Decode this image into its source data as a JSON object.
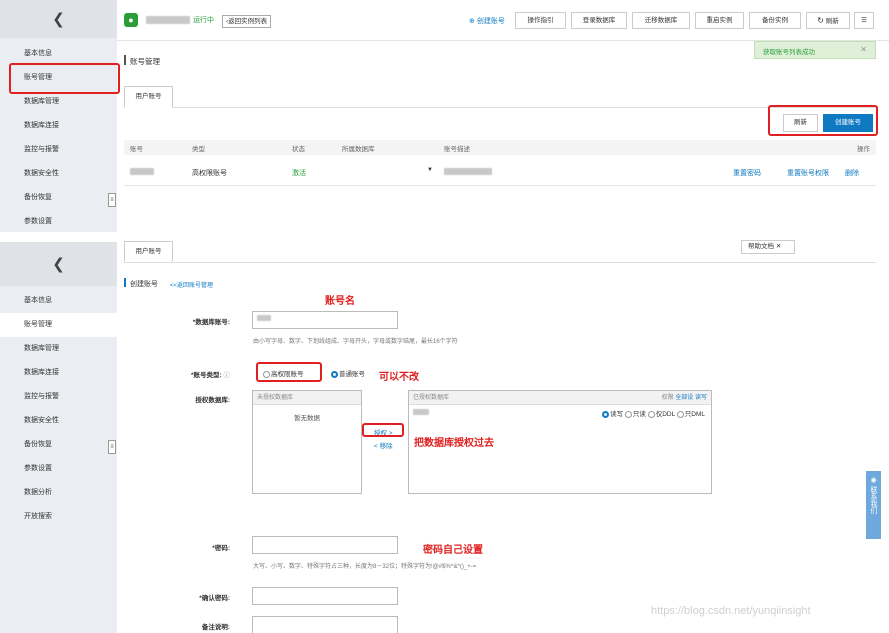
{
  "top": {
    "instance_status": "运行中",
    "back_to_list": "返回实例列表",
    "create_account_link": "创建账号",
    "toolbar_buttons": [
      "操作指引",
      "登录数据库",
      "迁移数据库",
      "重启实例",
      "备份实例",
      "刷新"
    ],
    "page_title": "账号管理",
    "tab_user_account": "用户账号",
    "toast": "获取账号列表成功",
    "refresh_button": "刷新",
    "create_button": "创建账号",
    "table": {
      "headers": [
        "账号",
        "类型",
        "状态",
        "所属数据库",
        "账号描述",
        "操作"
      ],
      "row": {
        "type": "高权限账号",
        "status": "激活"
      },
      "actions": [
        "重置密码",
        "重置账号权限",
        "删除"
      ]
    }
  },
  "sidebar_top": [
    "基本信息",
    "账号管理",
    "数据库管理",
    "数据库连接",
    "监控与报警",
    "数据安全性",
    "备份恢复",
    "参数设置"
  ],
  "sidebar_bottom": [
    "基本信息",
    "账号管理",
    "数据库管理",
    "数据库连接",
    "监控与报警",
    "数据安全性",
    "备份恢复",
    "参数设置",
    "数据分析",
    "开放搜索"
  ],
  "bottom": {
    "tab_user_account": "用户账号",
    "help_doc": "帮助文档",
    "page_title": "创建账号",
    "back_link": "<<返回账号管理",
    "db_account_label": "*数据库账号:",
    "db_account_hint": "由小写字母、数字、下划线组成、字母开头，字母或数字结尾，最长16个字符",
    "account_type_label": "*账号类型:",
    "type_high": "高权限账号",
    "type_normal": "普通账号",
    "auth_db_label": "授权数据库:",
    "unauth_header": "未授权数据库",
    "no_data": "暂无数据",
    "authorize_link": "授权 >",
    "remove_link": "< 移除",
    "authed_header": "已授权数据库",
    "authed_header_right": "权限",
    "all_set": "全部设",
    "set_rw": "读写",
    "perm_options": [
      "读写",
      "只读",
      "仅DDL",
      "只DML"
    ],
    "password_label": "*密码:",
    "password_hint": "大写、小写、数字、特殊字符占三种，长度为8－32位；特殊字符为!@#$%^&*()_+-=",
    "confirm_label": "*确认密码:",
    "remark_label": "备注说明:",
    "contact_us": "联系我们",
    "watermark": "https://blog.csdn.net/yunqiinsight"
  },
  "annotations": {
    "account_name": "账号名",
    "cannot_change": "可以不改",
    "grant_db": "把数据库授权过去",
    "set_password": "密码自己设置"
  },
  "colors": {
    "accent": "#0f7ac1",
    "annotation_red": "#e02020",
    "success_green": "#2a9d3a"
  }
}
